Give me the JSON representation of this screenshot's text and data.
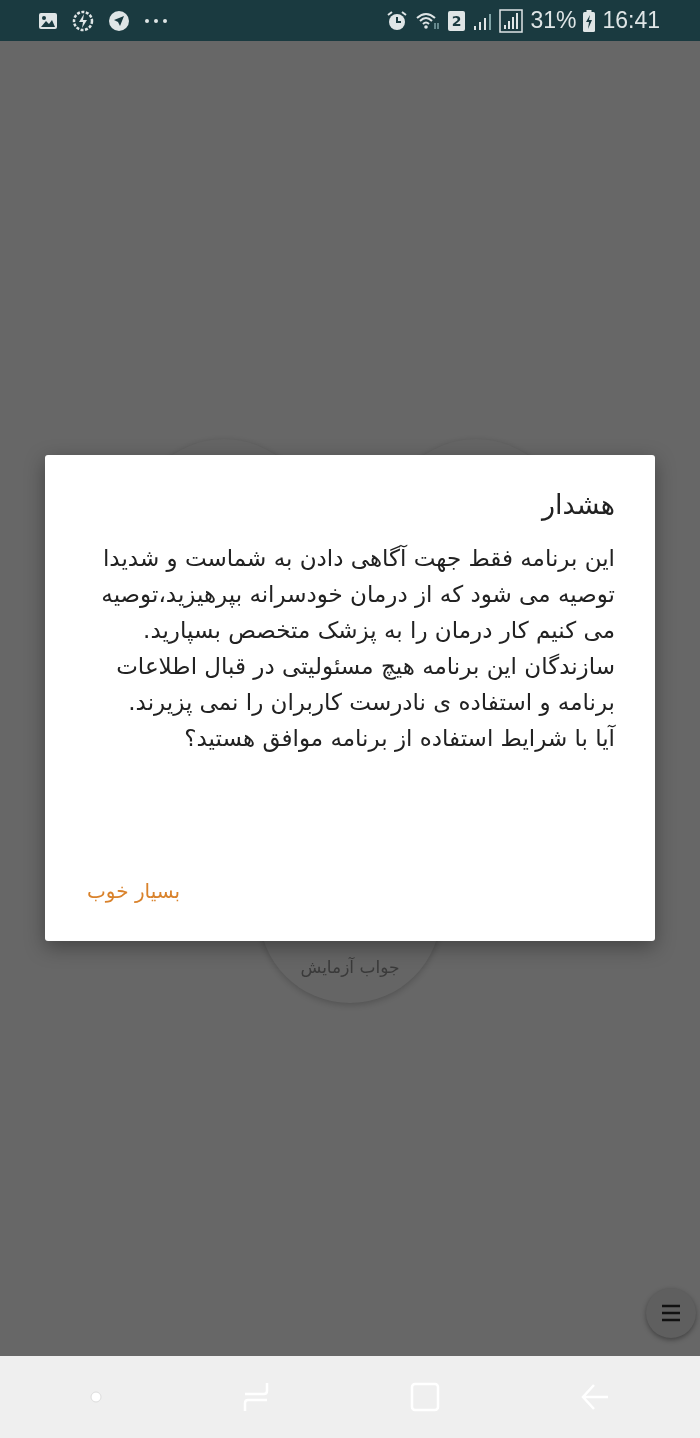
{
  "status_bar": {
    "sim_slot": "2",
    "battery": "31%",
    "time": "16:41"
  },
  "background": {
    "tile_label": "جواب آزمایش"
  },
  "dialog": {
    "title": "هشدار",
    "paragraphs": [
      "این برنامه فقط جهت آگاهی دادن به شماست و شدیدا توصیه می شود که از درمان خودسرانه بپرهیزید،توصیه می کنیم کار درمان را به پزشک متخصص بسپارید.",
      "سازندگان این برنامه هیچ مسئولیتی در قبال اطلاعات برنامه و استفاده ی نادرست کاربران را نمی پزیرند.",
      "آیا با شرایط استفاده از برنامه موافق هستید؟"
    ],
    "button": "بسیار خوب"
  }
}
